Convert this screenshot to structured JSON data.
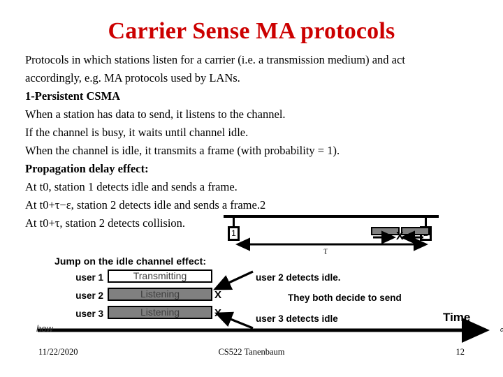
{
  "slide": {
    "title": "Carrier Sense MA protocols",
    "body_lines": [
      "Protocols in which stations listen for a carrier (i.e. a transmission medium) and act accordingly, e.g. MA protocols used by LANs.",
      "1-Persistent CSMA",
      "When a station has data to send, it listens to the channel.",
      "If the channel is busy, it waits until channel idle.",
      "When the channel is idle, it transmits a frame (with probability = 1).",
      "Propagation delay effect:",
      "At t0, station 1 detects idle and sends a frame.",
      "At t0+τ−ε, station 2 detects idle and sends a frame.2",
      "At t0+τ, station 2 detects collision."
    ]
  },
  "bus_diagram": {
    "station_1_label": "1",
    "station_2_label": "2",
    "collision_marker": "X",
    "tau_label": "τ"
  },
  "jump_diagram": {
    "heading": "Jump on the idle channel effect:",
    "rows": [
      {
        "user": "user 1",
        "state": "Transmitting",
        "cross": ""
      },
      {
        "user": "user 2",
        "state": "Listening",
        "cross": "X"
      },
      {
        "user": "user 3",
        "state": "Listening",
        "cross": "X"
      }
    ],
    "note_user2": "user 2 detects idle.",
    "note_both": "They both decide to send",
    "note_user3": "user 3 detects idle",
    "time_label": "Time",
    "time_axis_suffix": "c",
    "clipped_fragment": "how"
  },
  "footer": {
    "date": "11/22/2020",
    "center": "CS522 Tanenbaum",
    "page": "12"
  },
  "colors": {
    "title_red": "#cc0000",
    "bar_gray": "#808080",
    "ink_black": "#000000"
  }
}
